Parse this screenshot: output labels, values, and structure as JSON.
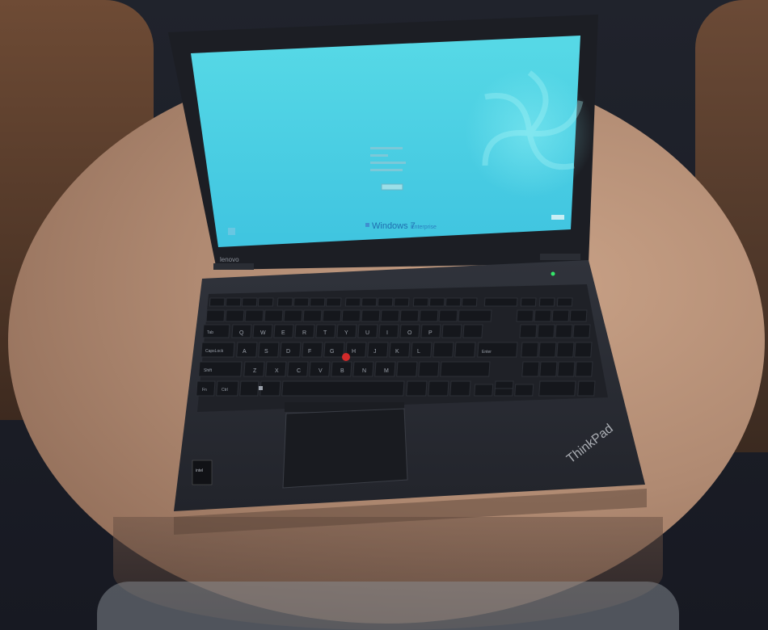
{
  "screen": {
    "menu_items": [
      "",
      "",
      "",
      ""
    ],
    "button_label": "",
    "windows_wordmark": "Windows 7",
    "edition": "Enterprise"
  },
  "laptop": {
    "screen_brand": "lenovo",
    "lid_brand": "ThinkPad",
    "intel_badge": "intel"
  },
  "keyboard": {
    "row_qwerty": [
      "Q",
      "W",
      "E",
      "R",
      "T",
      "Y",
      "U",
      "I",
      "O",
      "P"
    ],
    "row_asdf": [
      "A",
      "S",
      "D",
      "F",
      "G",
      "H",
      "J",
      "K",
      "L"
    ],
    "row_zxcv": [
      "Z",
      "X",
      "C",
      "V",
      "B",
      "N",
      "M"
    ],
    "label_tab": "Tab",
    "label_caps": "CapsLock",
    "label_shift": "Shift",
    "label_ctrl": "Ctrl",
    "label_fn": "Fn",
    "label_enter": "Enter"
  },
  "colors": {
    "screen_top": "#57d9e6",
    "screen_bottom": "#3fc4e0",
    "laptop_body": "#2b2e36",
    "trackpoint": "#d12a2a"
  }
}
